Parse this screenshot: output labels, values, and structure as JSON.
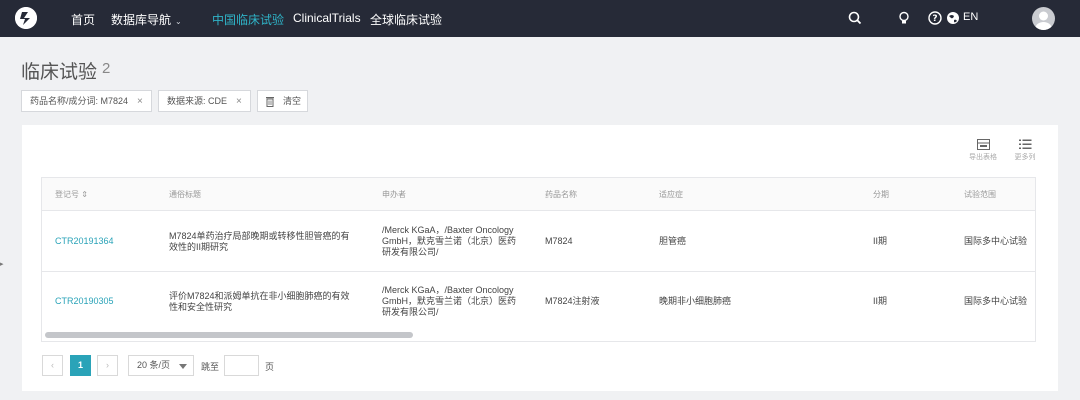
{
  "nav": {
    "items": [
      {
        "label": "首页"
      },
      {
        "label": "数据库导航"
      },
      {
        "label": "中国临床试验"
      },
      {
        "label": "ClinicalTrials"
      },
      {
        "label": "全球临床试验"
      }
    ],
    "lang": "EN",
    "active_color": "#2fb4c8",
    "bg_color": "#262a37"
  },
  "page": {
    "title": "临床试验",
    "count": "2"
  },
  "filters": [
    {
      "label": "药品名称/成分词: M7824"
    },
    {
      "label": "数据来源: CDE"
    }
  ],
  "clear_label": "清空",
  "tools": {
    "export_label": "导出表格",
    "more_cols_label": "更多列"
  },
  "table": {
    "headers": [
      "登记号 ⇕",
      "通俗标题",
      "申办者",
      "药品名称",
      "适应症",
      "分期",
      "试验范围"
    ],
    "rows": [
      {
        "reg_no": "CTR20191364",
        "title_l1": "M7824单药治疗局部晚期或转移性胆管癌的有",
        "title_l2": "效性的II期研究",
        "sponsor_l1": "/Merck KGaA，/Baxter Oncology",
        "sponsor_l2": "GmbH，默克雪兰诺（北京）医药",
        "sponsor_l3": "研发有限公司/",
        "drug": "M7824",
        "indication": "胆管癌",
        "phase": "II期",
        "scope": "国际多中心试验"
      },
      {
        "reg_no": "CTR20190305",
        "title_l1": "评价M7824和派姆单抗在非小细胞肺癌的有效",
        "title_l2": "性和安全性研究",
        "sponsor_l1": "/Merck KGaA，/Baxter Oncology",
        "sponsor_l2": "GmbH，默克雪兰诺（北京）医药",
        "sponsor_l3": "研发有限公司/",
        "drug": "M7824注射液",
        "indication": "晚期非小细胞肺癌",
        "phase": "II期",
        "scope": "国际多中心试验"
      }
    ]
  },
  "pagination": {
    "current_page": "1",
    "page_size": "20 条/页",
    "jump_label": "跳至",
    "page_suffix": "页",
    "prev": "‹",
    "next": "›"
  }
}
